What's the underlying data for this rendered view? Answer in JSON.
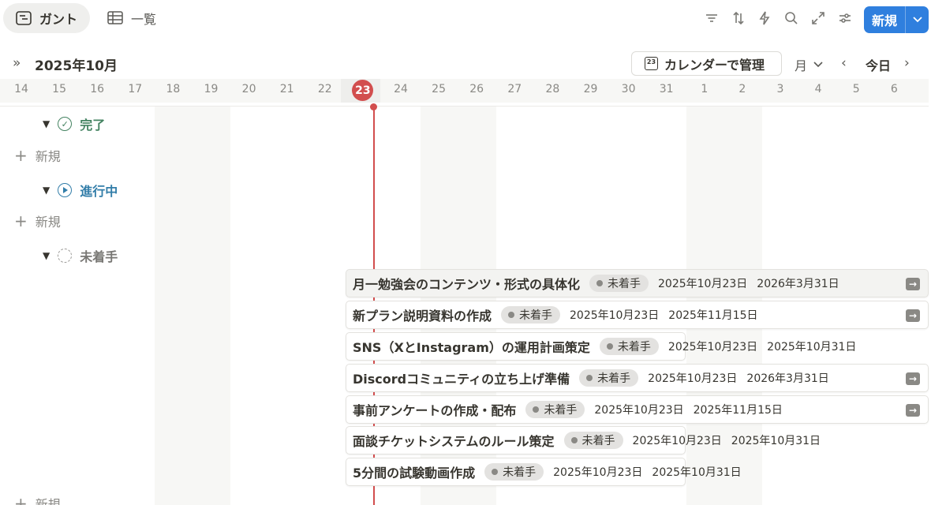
{
  "view_tabs": [
    {
      "label": "ガント",
      "icon": "gantt-icon",
      "active": true
    },
    {
      "label": "一覧",
      "icon": "table-icon",
      "active": false
    }
  ],
  "toolbar": {
    "icons": [
      "filter-icon",
      "sort-icon",
      "automation-icon",
      "search-icon",
      "expand-icon",
      "settings-icon"
    ],
    "new_label": "新規"
  },
  "header": {
    "month": "2025年10月",
    "calendar_button": "カレンダーで管理",
    "calendar_icon_text": "23",
    "period": "月",
    "today": "今日"
  },
  "dates": [
    "14",
    "15",
    "16",
    "17",
    "18",
    "19",
    "20",
    "21",
    "22",
    "23",
    "24",
    "25",
    "26",
    "27",
    "28",
    "29",
    "30",
    "31",
    "1",
    "2",
    "3",
    "4",
    "5",
    "6"
  ],
  "today_date": "23",
  "groups": [
    {
      "label": "完了",
      "status": "done",
      "add_label": "新規"
    },
    {
      "label": "進行中",
      "status": "in-progress",
      "add_label": "新規"
    },
    {
      "label": "未着手",
      "status": "not-started",
      "add_label": "新規"
    }
  ],
  "tasks": [
    {
      "title": "月一勉強会のコンテンツ・形式の具体化",
      "status": "未着手",
      "start": "2025年10月23日",
      "end": "2026年3月31日",
      "overflow": true
    },
    {
      "title": "新プラン説明資料の作成",
      "status": "未着手",
      "start": "2025年10月23日",
      "end": "2025年11月15日",
      "overflow": true
    },
    {
      "title": "SNS（XとInstagram）の運用計画策定",
      "status": "未着手",
      "start": "2025年10月23日",
      "end": "2025年10月31日",
      "overflow": false
    },
    {
      "title": "Discordコミュニティの立ち上げ準備",
      "status": "未着手",
      "start": "2025年10月23日",
      "end": "2026年3月31日",
      "overflow": true
    },
    {
      "title": "事前アンケートの作成・配布",
      "status": "未着手",
      "start": "2025年10月23日",
      "end": "2025年11月15日",
      "overflow": true
    },
    {
      "title": "面談チケットシステムのルール策定",
      "status": "未着手",
      "start": "2025年10月23日",
      "end": "2025年10月31日",
      "overflow": false
    },
    {
      "title": "5分間の試験動画作成",
      "status": "未着手",
      "start": "2025年10月23日",
      "end": "2025年10月31日",
      "overflow": false
    }
  ],
  "colors": {
    "accent": "#2f7fde",
    "today": "#d24e4e",
    "done": "#448361",
    "in_progress": "#337ea9"
  }
}
